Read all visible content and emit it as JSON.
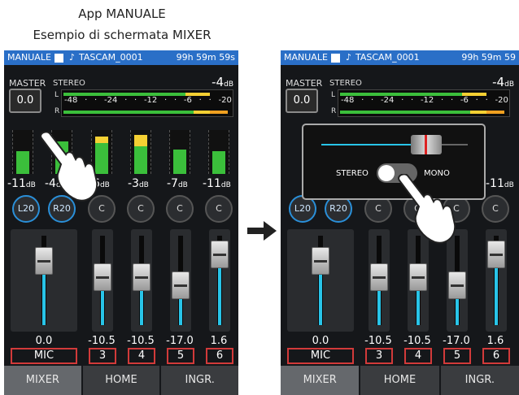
{
  "captions": {
    "line1": "App MANUALE",
    "line2": "Esempio di schermata MIXER"
  },
  "screens": {
    "left": {
      "topbar": {
        "title": "MANUALE",
        "file": "TASCAM_0001",
        "time": "99h 59m 59s"
      },
      "master": {
        "label": "MASTER",
        "value": "0.0",
        "stereo_label": "STEREO",
        "peak": "-4",
        "unit": "dB"
      },
      "meter": {
        "l": "L",
        "r": "R",
        "ticks": [
          "-48",
          "·",
          "·",
          "-24",
          "·",
          "·",
          "-12",
          "·",
          "·",
          "-6",
          "·",
          "·",
          "-20"
        ]
      },
      "channels": [
        {
          "name": "MIC",
          "value": "0.0",
          "db": "-11",
          "pan": "L20",
          "level": 0.55
        },
        {
          "name": "",
          "value": "",
          "db": "-4",
          "pan": "R20",
          "level": 0.75
        },
        {
          "name": "3",
          "value": "-10.5",
          "db": "-6",
          "pan": "C",
          "level": 0.7
        },
        {
          "name": "4",
          "value": "-10.5",
          "db": "-3",
          "pan": "C",
          "level": 0.8
        },
        {
          "name": "5",
          "value": "-17.0",
          "db": "-7",
          "pan": "C",
          "level": 0.65
        },
        {
          "name": "6",
          "value": "1.6",
          "db": "-11",
          "pan": "C",
          "level": 0.55
        }
      ],
      "bottom_tabs": [
        "MIXER",
        "HOME",
        "INGR."
      ]
    },
    "right": {
      "topbar": {
        "title": "MANUALE",
        "file": "TASCAM_0001",
        "time": "99h 59m 59"
      },
      "master": {
        "label": "MASTER",
        "value": "0.0",
        "stereo_label": "STEREO",
        "peak": "-4",
        "unit": "dB"
      },
      "meter": {
        "l": "L",
        "r": "R",
        "ticks": [
          "-48",
          "·",
          "·",
          "-24",
          "·",
          "·",
          "-12",
          "·",
          "·",
          "-6",
          "·",
          "·",
          "-20"
        ]
      },
      "popup": {
        "stereo": "STEREO",
        "mono": "MONO"
      },
      "db_right": "-11",
      "channels": [
        {
          "name": "MIC",
          "value": "0.0",
          "pan": "L20"
        },
        {
          "name": "",
          "value": "",
          "pan": "R20"
        },
        {
          "name": "3",
          "value": "-10.5",
          "pan": "C"
        },
        {
          "name": "4",
          "value": "-10.5",
          "pan": "C"
        },
        {
          "name": "5",
          "value": "-17.0",
          "pan": "C"
        },
        {
          "name": "6",
          "value": "1.6",
          "pan": "C"
        }
      ],
      "bottom_tabs": [
        "MIXER",
        "HOME",
        "INGR."
      ]
    }
  },
  "colors": {
    "accent": "#2a6fc7",
    "meter_green": "#3bbf3b",
    "meter_yellow": "#f5d033",
    "meter_orange": "#f0a020",
    "fader_cyan": "#28c4e8",
    "name_border": "#d23a3a"
  },
  "icons": {
    "note": "music-note-icon",
    "hand": "pointing-hand-icon",
    "arrow": "right-arrow-icon"
  }
}
